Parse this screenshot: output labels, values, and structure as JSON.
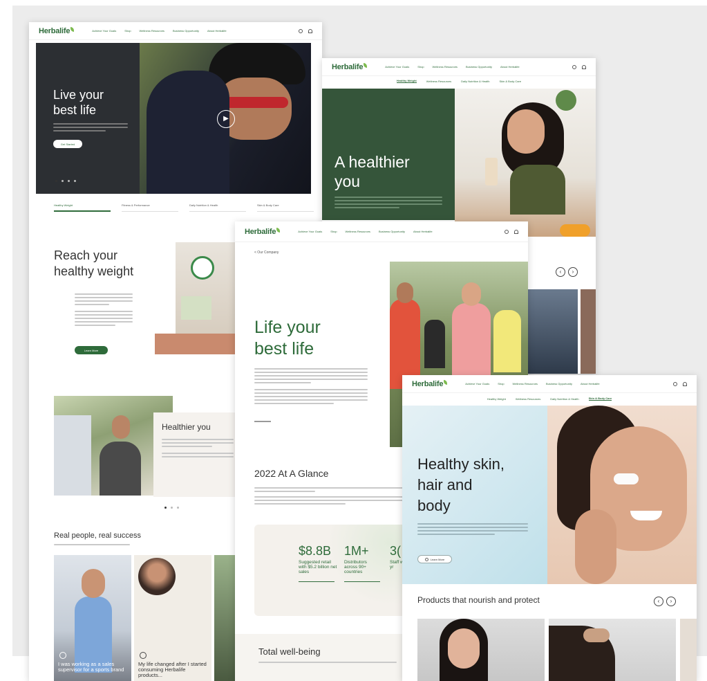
{
  "brand": "Herbalife",
  "nav": [
    "Achieve Your Goals",
    "Shop",
    "Wellness Resources",
    "Business Opportunity",
    "About Herbalife"
  ],
  "page1": {
    "hero_title_1": "Live your",
    "hero_title_2": "best life",
    "hero_cta": "Get Started",
    "tabs": [
      "Healthy Weight",
      "Fitness & Performance",
      "Daily Nutrition & Health",
      "Skin & Body Care"
    ],
    "section_title_1": "Reach your",
    "section_title_2": "healthy weight",
    "section_cta": "Learn More",
    "card_title": "Healthier you",
    "people_title": "Real people, real success",
    "story_1": "I was working as a sales supervisor for a sports brand",
    "story_2": "My life changed after I started consuming Herbalife products..."
  },
  "page2": {
    "subnav": [
      "Healthy Weight",
      "Wellness Resources",
      "Daily Nutrition & Health",
      "Skin & Body Care"
    ],
    "hero_title_1": "A healthier",
    "hero_title_2": "you"
  },
  "page3": {
    "back_link": "< Our Company",
    "hero_title_1": "Life your",
    "hero_title_2": "best life",
    "glance_title": "2022 At A Glance",
    "stats": [
      {
        "value": "$8.8B",
        "label": "Suggested retail with $5.2 billion net sales"
      },
      {
        "value": "1M+",
        "label": "Distributors across 90+ countries"
      },
      {
        "value": "3(",
        "label": "Staff with 15 yr"
      }
    ],
    "wellbeing_title": "Total well-being"
  },
  "page4": {
    "subnav": [
      "Healthy Weight",
      "Wellness Resources",
      "Daily Nutrition & Health",
      "Skin & Body Care"
    ],
    "hero_title_1": "Healthy skin,",
    "hero_title_2": "hair and",
    "hero_title_3": "body",
    "hero_cta": "Learn More",
    "products_title": "Products that nourish and protect"
  },
  "colors": {
    "brand_green": "#2e6b3a",
    "hero_dark_green": "#35553a",
    "skin_panel": "#cfe7ef"
  }
}
